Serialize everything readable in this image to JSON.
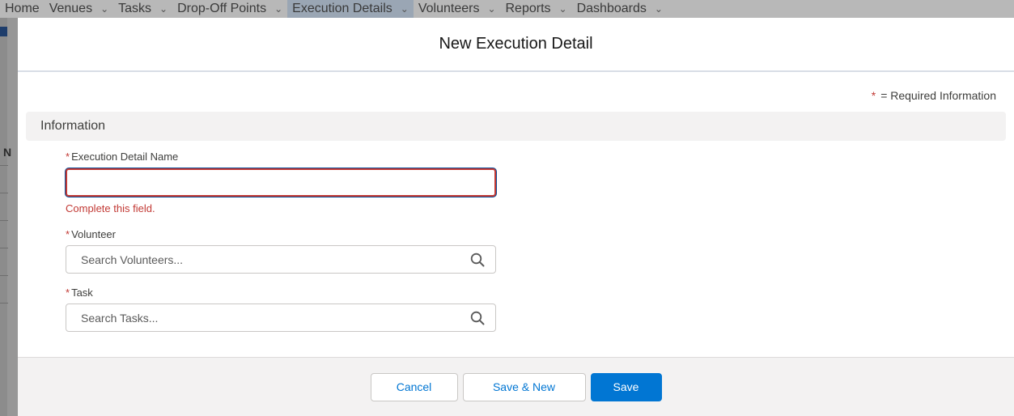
{
  "background_nav": {
    "items": [
      {
        "label": "Home",
        "chevron": false
      },
      {
        "label": "Venues",
        "chevron": true
      },
      {
        "label": "Tasks",
        "chevron": true
      },
      {
        "label": "Drop-Off Points",
        "chevron": true
      },
      {
        "label": "Execution Details",
        "chevron": true,
        "active": true
      },
      {
        "label": "Volunteers",
        "chevron": true
      },
      {
        "label": "Reports",
        "chevron": true
      },
      {
        "label": "Dashboards",
        "chevron": true
      }
    ]
  },
  "modal": {
    "title": "New Execution Detail",
    "required_legend": {
      "star": "*",
      "text": "= Required Information"
    },
    "section_title": "Information",
    "fields": {
      "name": {
        "required_marker": "*",
        "label": "Execution Detail Name",
        "value": "",
        "error": "Complete this field."
      },
      "volunteer": {
        "required_marker": "*",
        "label": "Volunteer",
        "placeholder": "Search Volunteers...",
        "icon": "search-icon"
      },
      "task": {
        "required_marker": "*",
        "label": "Task",
        "placeholder": "Search Tasks...",
        "icon": "search-icon"
      }
    },
    "footer": {
      "cancel_label": "Cancel",
      "save_new_label": "Save & New",
      "save_label": "Save"
    }
  },
  "colors": {
    "brand": "#0176d3",
    "error": "#c23934",
    "section_bg": "#f3f2f2"
  }
}
